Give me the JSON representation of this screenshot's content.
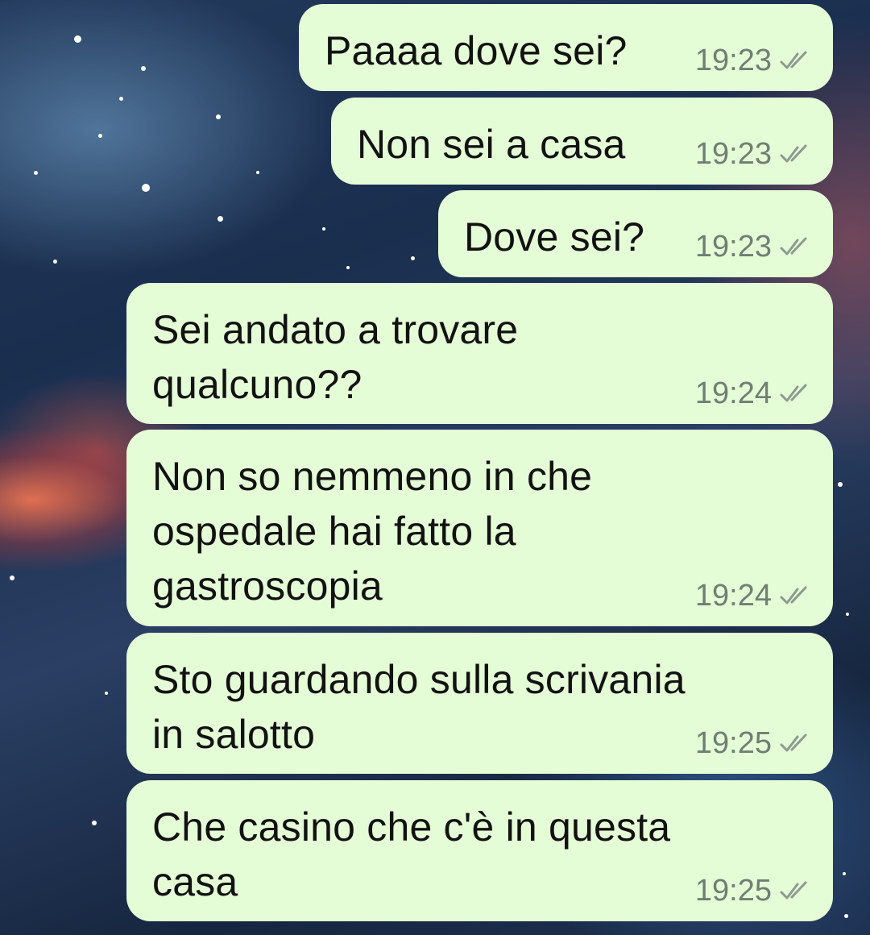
{
  "conversation": {
    "messages": [
      {
        "text": "Paaaa dove sei?",
        "time": "19:23",
        "status": "sent",
        "status_icon": "double-check-icon"
      },
      {
        "text": "Non sei a casa",
        "time": "19:23",
        "status": "sent",
        "status_icon": "double-check-icon"
      },
      {
        "text": "Dove sei?",
        "time": "19:23",
        "status": "sent",
        "status_icon": "double-check-icon"
      },
      {
        "text": "Sei andato a trovare\nqualcuno??",
        "time": "19:24",
        "status": "sent",
        "status_icon": "double-check-icon"
      },
      {
        "text": "Non so nemmeno in che\nospedale hai fatto la\ngastroscopia",
        "time": "19:24",
        "status": "sent",
        "status_icon": "double-check-icon"
      },
      {
        "text": "Sto guardando sulla scrivania\nin salotto",
        "time": "19:25",
        "status": "sent",
        "status_icon": "double-check-icon"
      },
      {
        "text": "Che casino che c'è in questa\ncasa",
        "time": "19:25",
        "status": "sent",
        "status_icon": "double-check-icon"
      }
    ]
  },
  "colors": {
    "bubble_background": "#e5fdd6",
    "message_text": "#121212",
    "timestamp": "#6f7f73",
    "check_marks": "#8c9a90"
  }
}
